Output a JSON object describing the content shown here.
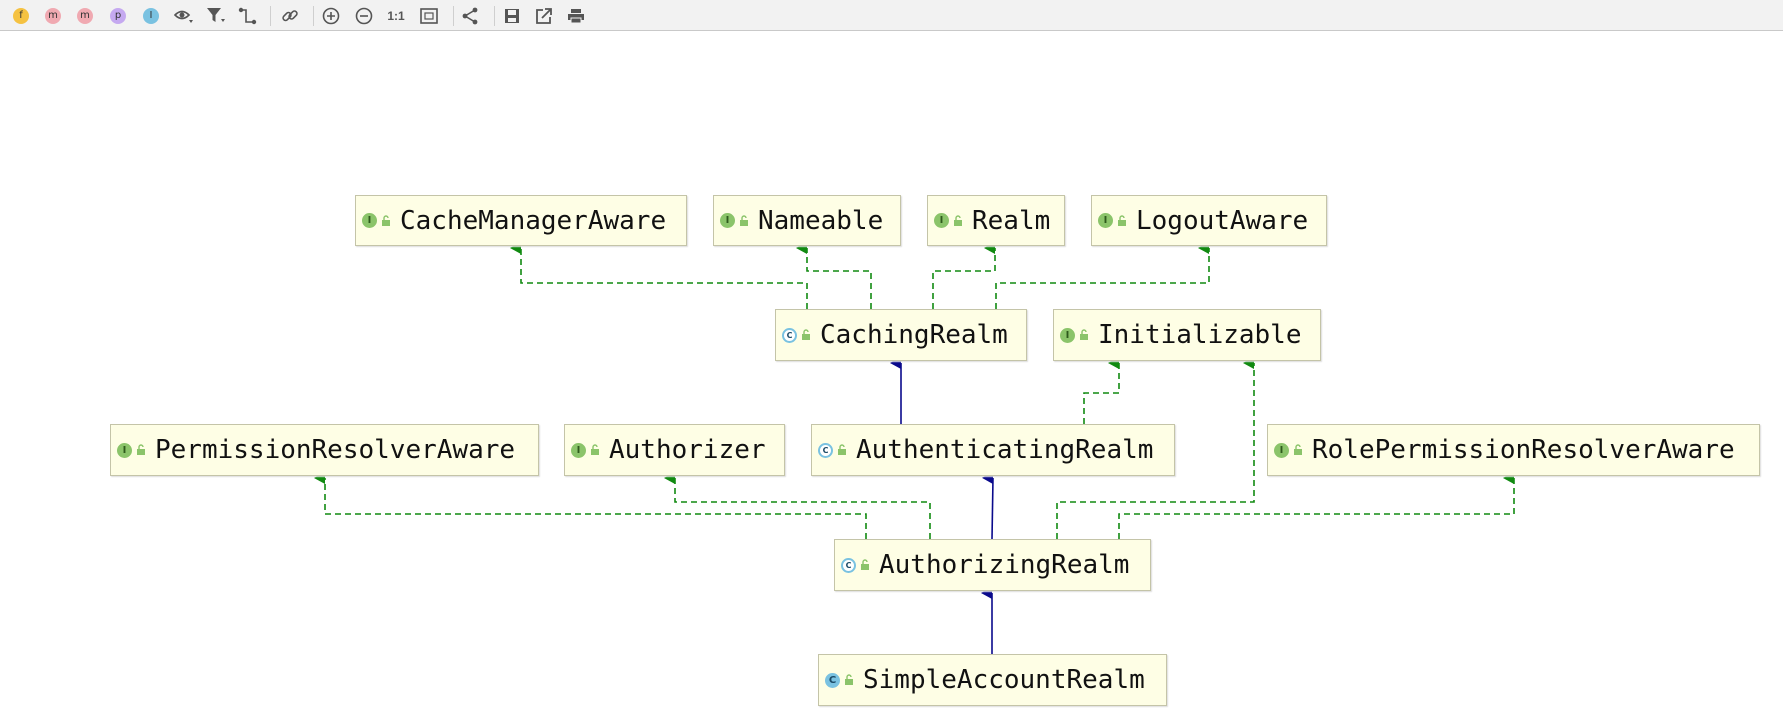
{
  "toolbar": {
    "filters": [
      {
        "icon": "f-fields-icon",
        "glyph": "f",
        "color": "#f5c242"
      },
      {
        "icon": "m-constructors-icon",
        "glyph": "m",
        "color": "#f0a9b1"
      },
      {
        "icon": "m-methods-icon",
        "glyph": "m",
        "color": "#f0a9b1"
      },
      {
        "icon": "p-properties-icon",
        "glyph": "p",
        "color": "#c5a9f0"
      },
      {
        "icon": "i-inner-classes-icon",
        "glyph": "I",
        "color": "#7ac2e1"
      }
    ],
    "zoom_actual_label": "1:1"
  },
  "diagram": {
    "nodes": [
      {
        "id": "cache-manager-aware",
        "kind": "I",
        "label": "CacheManagerAware"
      },
      {
        "id": "nameable",
        "kind": "I",
        "label": "Nameable"
      },
      {
        "id": "realm",
        "kind": "I",
        "label": "Realm"
      },
      {
        "id": "logout-aware",
        "kind": "I",
        "label": "LogoutAware"
      },
      {
        "id": "caching-realm",
        "kind": "C",
        "label": "CachingRealm"
      },
      {
        "id": "initializable",
        "kind": "I",
        "label": "Initializable"
      },
      {
        "id": "permission-resolver-aware",
        "kind": "I",
        "label": "PermissionResolverAware"
      },
      {
        "id": "authorizer",
        "kind": "I",
        "label": "Authorizer"
      },
      {
        "id": "authenticating-realm",
        "kind": "C",
        "label": "AuthenticatingRealm"
      },
      {
        "id": "role-permission-resolver-aware",
        "kind": "I",
        "label": "RolePermissionResolverAware"
      },
      {
        "id": "authorizing-realm",
        "kind": "C",
        "label": "AuthorizingRealm"
      },
      {
        "id": "simple-account-realm",
        "kind": "C",
        "label": "SimpleAccountRealm"
      }
    ],
    "colors": {
      "implements": "#118a11",
      "extends": "#0a0a8c",
      "node_fill": "#fefee5",
      "node_border": "#c4c4a8",
      "interface_badge": "#8bc46a",
      "class_badge": "#7ac2e1"
    }
  }
}
